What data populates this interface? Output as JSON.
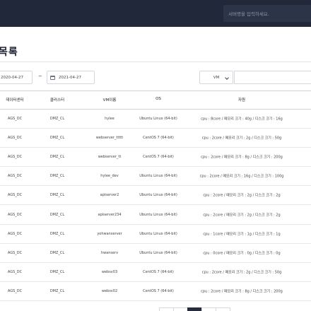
{
  "header": {
    "search_placeholder": "서버명을 입력하세요."
  },
  "page": {
    "title": "목록"
  },
  "filters": {
    "date_from": "2020-04-27",
    "date_separator": "~",
    "date_to": "2021-04-27",
    "type_selected": "VM",
    "keyword_value": ""
  },
  "table": {
    "columns": [
      "데이터센터",
      "클러스터",
      "VM이름",
      "OS",
      "자원"
    ],
    "rows": [
      [
        "AGS_DC",
        "DMZ_CL",
        "hylee",
        "Ubuntu Linux (64-bit)",
        "cpu : 8core / 메모리 크기 : 40g / 디스크 크기 : 16g"
      ],
      [
        "AGS_DC",
        "DMZ_CL",
        "webserver_ttttt",
        "CentOS 7 (64-bit)",
        "cpu : 2core / 메모리 크기 : 2g / 디스크 크기 : 50g"
      ],
      [
        "AGS_DC",
        "DMZ_CL",
        "webserver_tt",
        "CentOS 7 (64-bit)",
        "cpu : 2core / 메모리 크기 : 8g / 디스크 크기 : 200g"
      ],
      [
        "AGS_DC",
        "DMZ_CL",
        "hylee_dev",
        "Ubuntu Linux (64-bit)",
        "cpu : 2core / 메모리 크기 : 16g / 디스크 크기 : 100g"
      ],
      [
        "AGS_DC",
        "DMZ_CL",
        "apiserver2",
        "Ubuntu Linux (64-bit)",
        "cpu : 2core / 메모리 크기 : 2g / 디스크 크기 : 2g"
      ],
      [
        "AGS_DC",
        "DMZ_CL",
        "apiserver234",
        "Ubuntu Linux (64-bit)",
        "cpu : 2core / 메모리 크기 : 2g / 디스크 크기 : 2g"
      ],
      [
        "AGS_DC",
        "DMZ_CL",
        "yohwanserver",
        "Ubuntu Linux (64-bit)",
        "cpu : 1core / 메모리 크기 : 1g / 디스크 크기 : 1g"
      ],
      [
        "AGS_DC",
        "DMZ_CL",
        "hwanserv",
        "Ubuntu Linux (64-bit)",
        "cpu : 0core / 메모리 크기 : 0g / 디스크 크기 : 0g"
      ],
      [
        "AGS_DC",
        "DMZ_CL",
        "websv03",
        "CentOS 7 (64-bit)",
        "cpu : 2core / 메모리 크기 : 2g / 디스크 크기 : 50g"
      ],
      [
        "AGS_DC",
        "DMZ_CL",
        "websv02",
        "CentOS 7 (64-bit)",
        "cpu : 2core / 메모리 크기 : 8g / 디스크 크기 : 200g"
      ]
    ]
  },
  "pagination": {
    "pages": [
      "",
      "",
      "",
      "",
      ""
    ],
    "active_index": 2
  },
  "colors": {
    "header_bg": "#21283a",
    "active_page": "#262c3e"
  }
}
